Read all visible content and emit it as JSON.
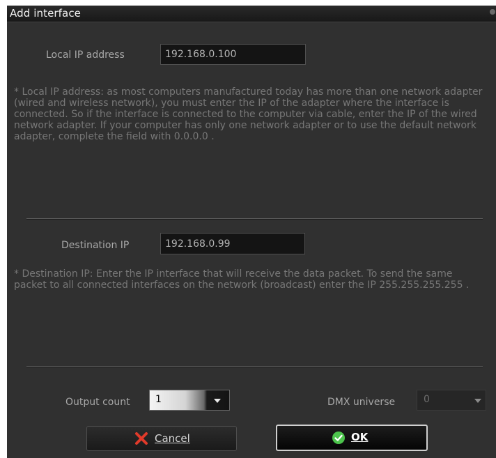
{
  "dialog": {
    "title": "Add interface"
  },
  "local_ip": {
    "label": "Local IP address",
    "value": "192.168.0.100",
    "description": "* Local IP address: as most computers manufactured today has more than one network adapter (wired and wireless network), you must enter the IP of the adapter where the interface is connected. So if the interface is connected to the computer via cable, enter the IP of the wired network adapter. If your computer has only one network adapter or to use the default network adapter, complete the field with 0.0.0.0 ."
  },
  "destination_ip": {
    "label": "Destination IP",
    "value": "192.168.0.99",
    "description": "* Destination IP: Enter the IP interface that will receive the data packet. To send the same packet to all connected interfaces on the network (broadcast) enter the IP 255.255.255.255 ."
  },
  "output_count": {
    "label": "Output count",
    "selected": "1"
  },
  "dmx_universe": {
    "label": "DMX universe",
    "selected": "0"
  },
  "buttons": {
    "cancel_label": "Cancel",
    "ok_label": "OK"
  },
  "colors": {
    "cancel_icon": "#e03a2a",
    "ok_icon": "#4cc44c",
    "background": "#303030"
  }
}
